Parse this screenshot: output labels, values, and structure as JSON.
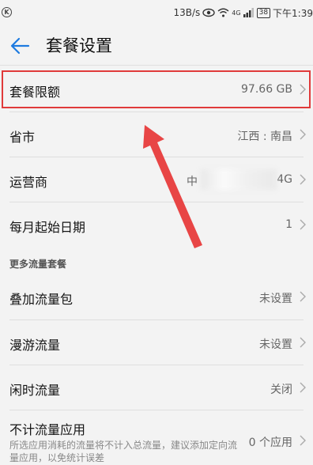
{
  "status_bar": {
    "left_badge": "K",
    "speed": "13B/s",
    "signal_label": "4G",
    "battery": "38",
    "time": "下午1:39"
  },
  "header": {
    "title": "套餐设置"
  },
  "rows": [
    {
      "label": "套餐限额",
      "value": "97.66 GB"
    },
    {
      "label": "省市",
      "value": "江西 : 南昌"
    },
    {
      "label": "运营商",
      "value_prefix": "中",
      "value_suffix": "4G"
    },
    {
      "label": "每月起始日期",
      "value": "1"
    }
  ],
  "section": {
    "title": "更多流量套餐"
  },
  "more_rows": [
    {
      "label": "叠加流量包",
      "value": "未设置"
    },
    {
      "label": "漫游流量",
      "value": "未设置"
    },
    {
      "label": "闲时流量",
      "value": "关闭"
    },
    {
      "label": "不计流量应用",
      "value": "0 个应用",
      "description": "所选应用消耗的流量将不计入总流量，建议添加定向流量应用，以免统计误差"
    }
  ],
  "colors": {
    "accent": "#1e7be0",
    "highlight": "#e03a3a",
    "background": "#f3f3f3"
  }
}
